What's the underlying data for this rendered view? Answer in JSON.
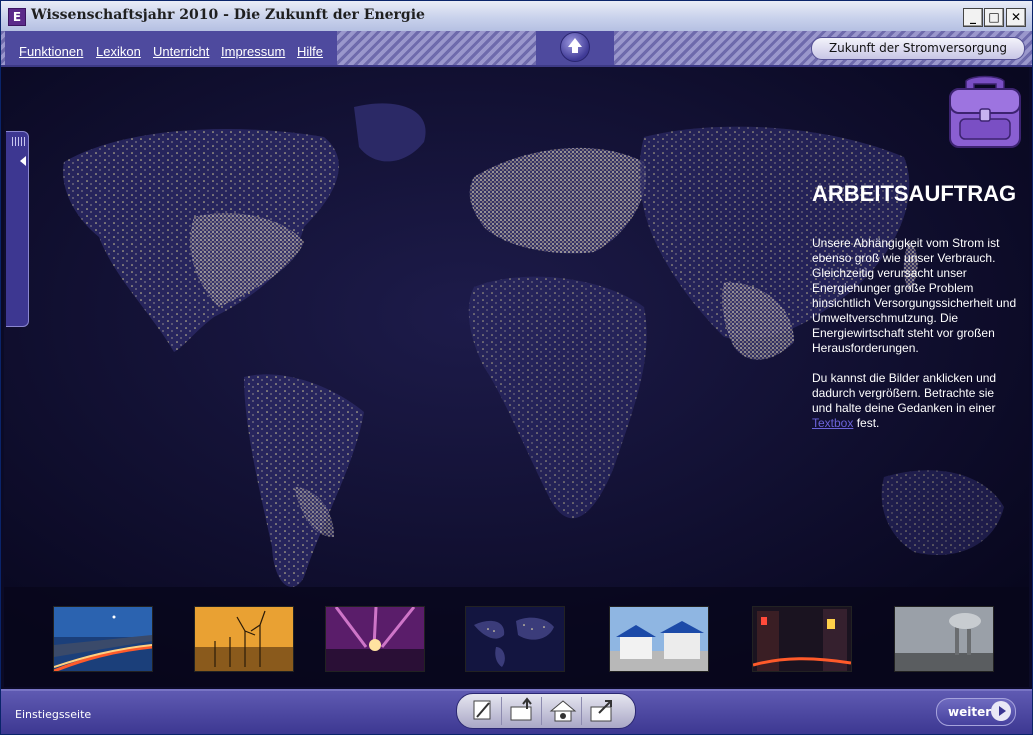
{
  "window": {
    "title": "Wissenschaftsjahr 2010 - Die Zukunft der Energie",
    "app_icon_letter": "E",
    "minimize_glyph": "_",
    "maximize_glyph": "□",
    "close_glyph": "✕"
  },
  "menu": {
    "items": [
      "Funktionen",
      "Lexikon",
      "Unterricht",
      "Impressum",
      "Hilfe"
    ],
    "topic_button": "Zukunft der Stromversorgung"
  },
  "task": {
    "heading": "ARBEITSAUFTRAG",
    "paragraph1": "Unsere Abhängigkeit vom Strom ist ebenso groß wie unser Verbrauch. Gleichzeitig verursacht unser Energiehunger große Problem hinsichtlich Versorgungssicherheit und Umweltverschmutzung. Die Energiewirtschaft steht vor großen Herausforderungen.",
    "paragraph2_before": "Du kannst die Bilder anklicken und dadurch vergrößern. Betrachte sie und halte deine Gedanken in einer ",
    "paragraph2_link": "Textbox",
    "paragraph2_after": " fest."
  },
  "thumbnails": [
    "highway-night",
    "wind-turbines-sunset",
    "concert-stage-lights",
    "earth-at-night",
    "solar-houses",
    "city-night-traffic",
    "industrial-smog"
  ],
  "bottom": {
    "status_label": "Einstiegsseite",
    "next_label": "weiter"
  },
  "colors": {
    "accent": "#4e4a9e",
    "link": "#6b63d9",
    "night_background": "#0c0b2a"
  }
}
